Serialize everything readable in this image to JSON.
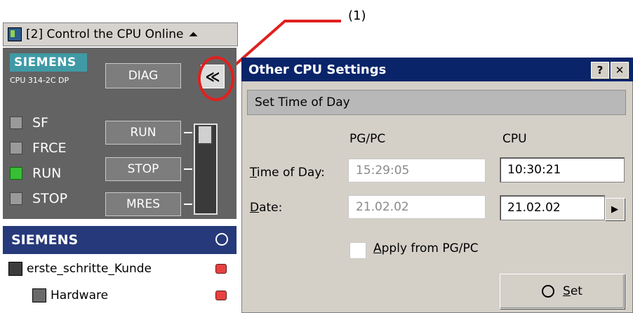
{
  "callout": {
    "label": "(1)",
    "accent": "#e0201f"
  },
  "left_panel": {
    "title": "[2] Control the CPU Online",
    "collapse_glyph": "≪",
    "brand": "SIEMENS",
    "cpu_model": "CPU 314-2C DP",
    "diag_label": "DIAG",
    "leds": [
      {
        "label": "SF",
        "on": false
      },
      {
        "label": "FRCE",
        "on": false
      },
      {
        "label": "RUN",
        "on": true
      },
      {
        "label": "STOP",
        "on": false
      }
    ],
    "mode_buttons": [
      "RUN",
      "STOP",
      "MRES"
    ]
  },
  "project": {
    "header": "SIEMENS",
    "items": [
      {
        "label": "erste_schritte_Kunde"
      },
      {
        "label": "Hardware"
      }
    ]
  },
  "dialog": {
    "title": "Other CPU Settings",
    "help": "?",
    "close": "✕",
    "section": "Set Time of Day",
    "col_pg": "PG/PC",
    "col_cpu": "CPU",
    "time_label_hot": "T",
    "time_label_rest": "ime of Day:",
    "date_label_hot": "D",
    "date_label_rest": "ate:",
    "pg_time": "15:29:05",
    "cpu_time": "10:30:21",
    "pg_date": "21.02.02",
    "cpu_date": "21.02.02",
    "spin_glyph": "▶",
    "apply_hot": "A",
    "apply_rest": "pply from PG/PC",
    "apply_checked": false,
    "set_hot": "S",
    "set_rest": "et"
  }
}
